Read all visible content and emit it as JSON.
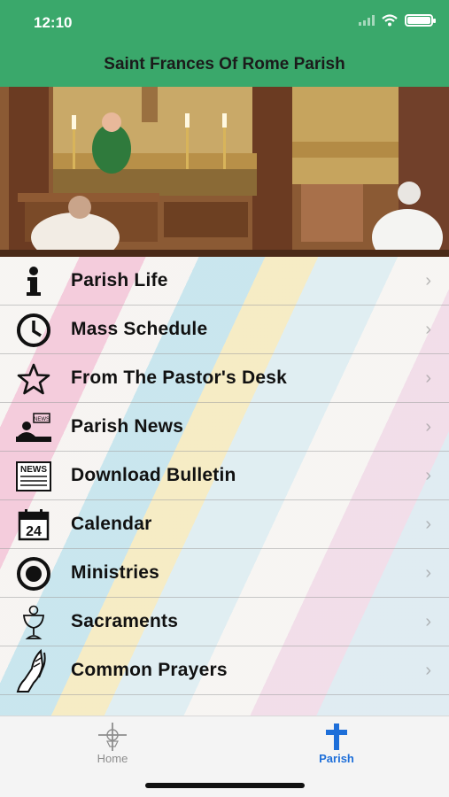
{
  "status": {
    "time": "12:10"
  },
  "header": {
    "title": "Saint Frances Of Rome Parish"
  },
  "menu": [
    {
      "label": "Parish Life",
      "icon": "info-icon"
    },
    {
      "label": "Mass Schedule",
      "icon": "clock-icon"
    },
    {
      "label": "From The Pastor's Desk",
      "icon": "star-icon"
    },
    {
      "label": "Parish News",
      "icon": "news-icon",
      "icon_text": "NEWS"
    },
    {
      "label": "Download Bulletin",
      "icon": "newspaper-icon",
      "icon_text": "NEWS"
    },
    {
      "label": "Calendar",
      "icon": "calendar-icon",
      "icon_text": "24"
    },
    {
      "label": "Ministries",
      "icon": "target-icon"
    },
    {
      "label": "Sacraments",
      "icon": "chalice-icon"
    },
    {
      "label": "Common Prayers",
      "icon": "praying-hands-icon"
    }
  ],
  "tabbar": {
    "home_label": "Home",
    "parish_label": "Parish",
    "active_color": "#1e6fd9",
    "inactive_color": "#8e8e8e"
  },
  "colors": {
    "header_bg": "#3aa86b"
  }
}
